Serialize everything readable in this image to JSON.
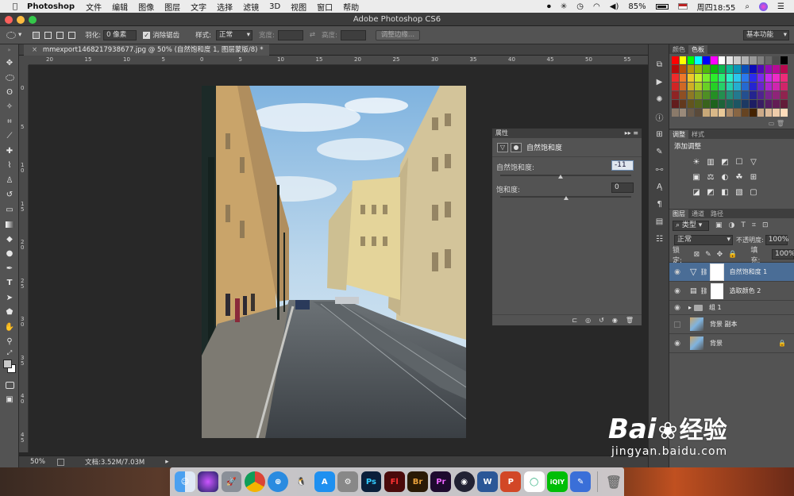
{
  "menubar": {
    "app_name": "Photoshop",
    "menus": [
      "文件",
      "编辑",
      "图像",
      "图层",
      "文字",
      "选择",
      "滤镜",
      "3D",
      "视图",
      "窗口",
      "帮助"
    ],
    "battery": "85%",
    "clock": "周四18:55"
  },
  "window": {
    "title": "Adobe Photoshop CS6"
  },
  "options_bar": {
    "feather_label": "羽化:",
    "feather_value": "0 像素",
    "antialias_label": "消除锯齿",
    "style_label": "样式:",
    "style_value": "正常",
    "width_label": "宽度:",
    "height_label": "高度:",
    "refine_edge_button": "调整边缘...",
    "workspace": "基本功能"
  },
  "document": {
    "tab_title": "mmexport1468217938677.jpg @ 50% (自然饱和度 1, 图层蒙版/8) *",
    "ruler_h": [
      "20",
      "15",
      "10",
      "5",
      "0",
      "5",
      "10",
      "15",
      "20",
      "25",
      "30",
      "35",
      "40",
      "45",
      "50",
      "55"
    ],
    "ruler_v": [
      "0",
      "5",
      "1\n0",
      "1\n5",
      "2\n0",
      "2\n5",
      "3\n0",
      "3\n5",
      "4\n0",
      "4\n5"
    ],
    "zoom": "50%",
    "doc_info": "文档:3.52M/7.03M"
  },
  "properties": {
    "panel_title": "属性",
    "adjustment_name": "自然饱和度",
    "vibrance_label": "自然饱和度:",
    "vibrance_value": "-11",
    "vibrance_level": 0.46,
    "saturation_label": "饱和度:",
    "saturation_value": "0",
    "saturation_level": 0.5
  },
  "color_panel": {
    "tabs": [
      "颜色",
      "色板"
    ],
    "active": "色板"
  },
  "adjust_panel": {
    "tabs": [
      "调整",
      "样式"
    ],
    "add_label": "添加调整"
  },
  "layers_panel": {
    "tabs": [
      "图层",
      "通道",
      "路径"
    ],
    "filter_label": "类型",
    "blend_mode": "正常",
    "opacity_label": "不透明度:",
    "opacity_value": "100%",
    "lock_label": "锁定:",
    "fill_label": "填充:",
    "fill_value": "100%",
    "layers": [
      {
        "name": "自然饱和度 1",
        "visible": true,
        "selected": true
      },
      {
        "name": "选取颜色 2",
        "visible": true,
        "selected": false
      },
      {
        "name": "组 1",
        "visible": true,
        "selected": false
      },
      {
        "name": "背景 副本",
        "visible": false,
        "selected": false
      },
      {
        "name": "背景",
        "visible": true,
        "selected": false
      }
    ]
  },
  "watermark": {
    "brand": "Bai",
    "brand2": "经验",
    "url": "jingyan.baidu.com"
  },
  "colors": {
    "accent": "#4a6d96",
    "panel": "#535353"
  }
}
